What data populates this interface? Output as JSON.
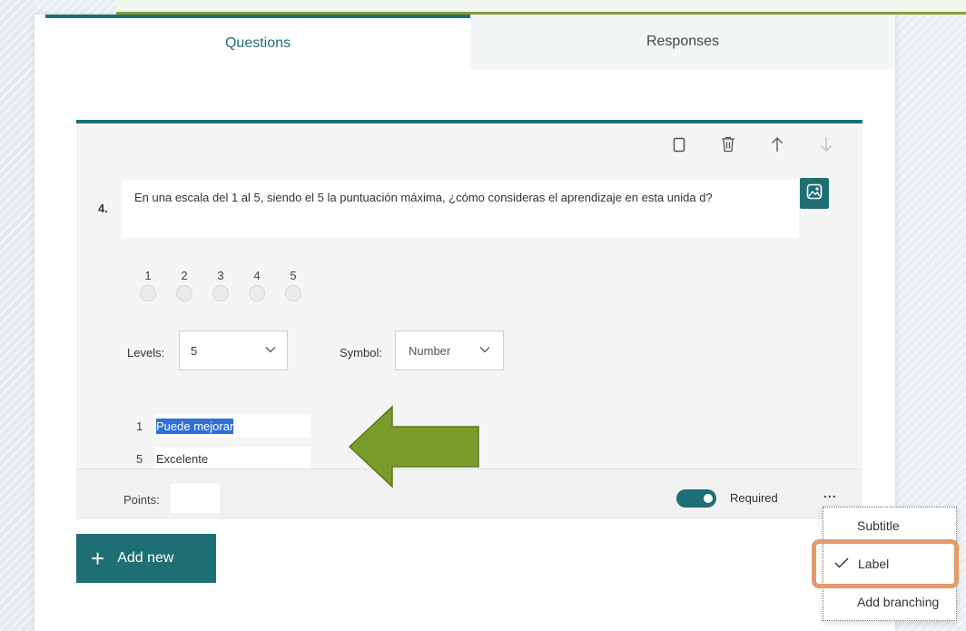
{
  "tabs": {
    "questions": "Questions",
    "responses": "Responses"
  },
  "question": {
    "number": "4.",
    "text": "En una escala del 1 al 5, siendo el 5 la puntuación máxima, ¿cómo consideras el aprendizaje en esta unida d?",
    "scale": [
      "1",
      "2",
      "3",
      "4",
      "5"
    ],
    "levels_label": "Levels:",
    "levels_value": "5",
    "symbol_label": "Symbol:",
    "symbol_value": "Number",
    "labels": [
      {
        "num": "1",
        "text": "Puede mejorar",
        "selected": true
      },
      {
        "num": "5",
        "text": "Excelente",
        "selected": false
      }
    ],
    "points_label": "Points:",
    "points_value": "",
    "required_label": "Required",
    "required_on": true,
    "more_glyph": "..."
  },
  "icons": {
    "toolbar": [
      "copy-icon",
      "delete-icon",
      "move-up-icon",
      "move-down-icon"
    ],
    "image": "insert-image-icon",
    "chevron": "chevron-down-icon",
    "arrow": "green-arrow-pointer"
  },
  "add_new": {
    "glyph": "+",
    "label": "Add new"
  },
  "menu": {
    "subtitle": "Subtitle",
    "label": "Label",
    "label_checked": true,
    "branching": "Add branching"
  },
  "colors": {
    "accent": "#1e6f74",
    "arrow": "#7a9a2a",
    "highlight": "#e39b6a",
    "selection": "#2f6fd8"
  }
}
